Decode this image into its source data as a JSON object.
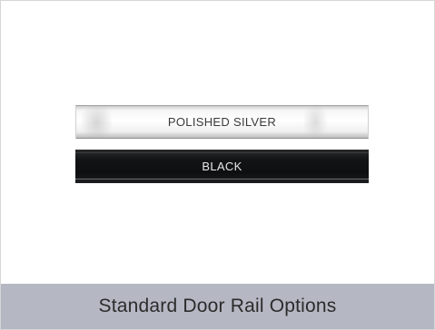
{
  "options": {
    "silver_label": "POLISHED SILVER",
    "black_label": "BLACK"
  },
  "caption": "Standard Door Rail Options",
  "colors": {
    "caption_bar": "#b5b8c3",
    "black_rail": "#0d0f10",
    "silver_rail": "#f2f2f2"
  }
}
